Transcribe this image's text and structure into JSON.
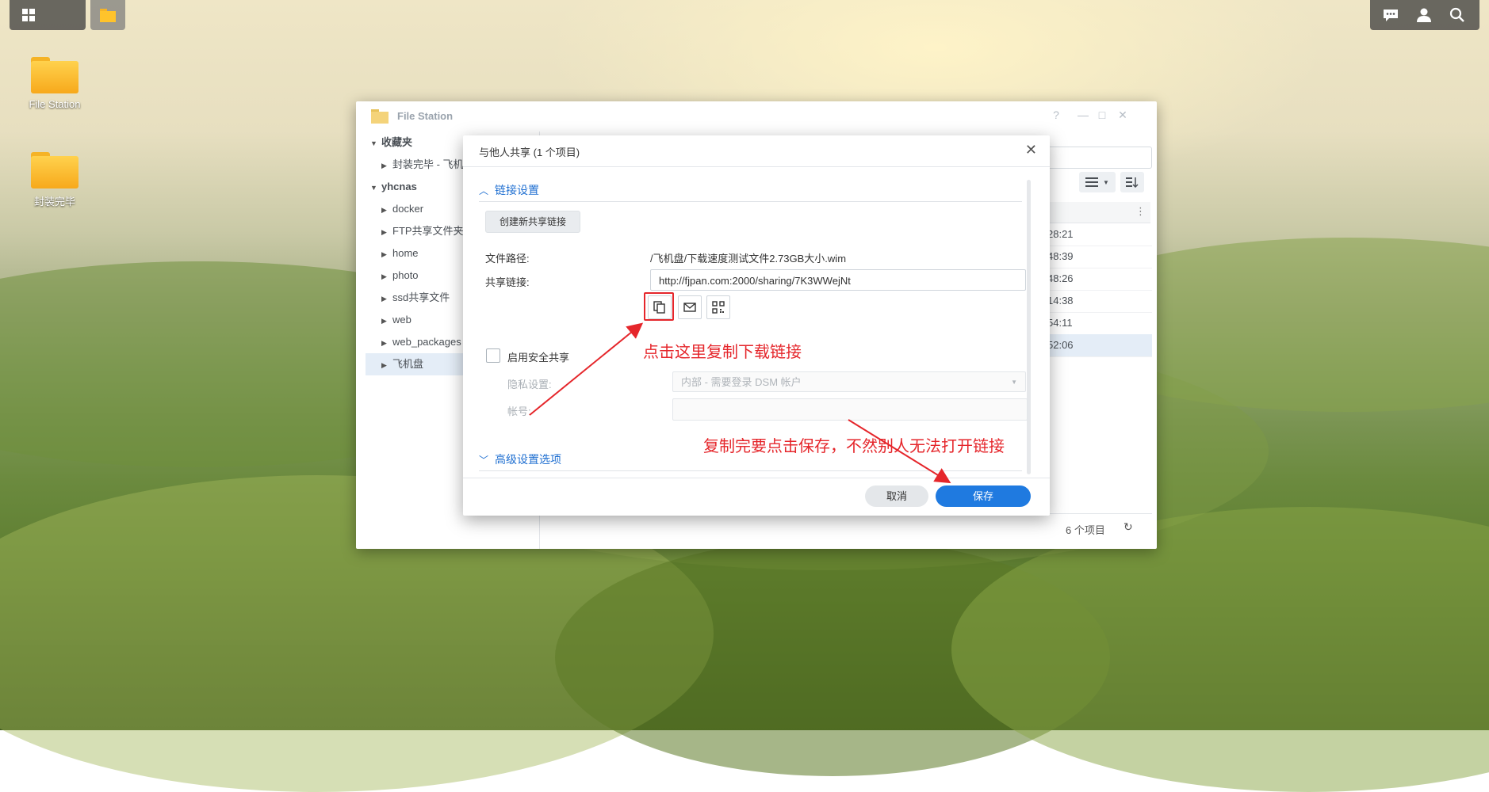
{
  "taskbar": {
    "left_icons": [
      "grid-icon",
      "file-station-icon"
    ],
    "right_icons": [
      "chat-icon",
      "user-icon",
      "search-icon"
    ]
  },
  "desktop": {
    "icons": [
      {
        "label": "File Station"
      },
      {
        "label": "封装完毕"
      }
    ]
  },
  "file_station": {
    "title": "File Station",
    "window_controls": [
      "?",
      "—",
      "□",
      "✕"
    ],
    "tree": [
      {
        "label": "收藏夹",
        "level": 0,
        "expanded": true
      },
      {
        "label": "封装完毕 - 飞机",
        "level": 1,
        "expanded": false
      },
      {
        "label": "yhcnas",
        "level": 0,
        "expanded": true
      },
      {
        "label": "docker",
        "level": 1,
        "expanded": false
      },
      {
        "label": "FTP共享文件夹",
        "level": 1,
        "expanded": false
      },
      {
        "label": "home",
        "level": 1,
        "expanded": false
      },
      {
        "label": "photo",
        "level": 1,
        "expanded": false
      },
      {
        "label": "ssd共享文件",
        "level": 1,
        "expanded": false
      },
      {
        "label": "web",
        "level": 1,
        "expanded": false
      },
      {
        "label": "web_packages",
        "level": 1,
        "expanded": false
      },
      {
        "label": "飞机盘",
        "level": 1,
        "expanded": false,
        "selected": true
      }
    ],
    "times": [
      "28:21",
      "48:39",
      "48:26",
      "14:38",
      "54:11",
      "52:06"
    ],
    "item_count": "6 个项目"
  },
  "dialog": {
    "title": "与他人共享 (1 个项目)",
    "link_section": "链接设置",
    "create_button": "创建新共享链接",
    "path_label": "文件路径:",
    "path_value": "/飞机盘/下载速度测试文件2.73GB大小.wim",
    "link_label": "共享链接:",
    "link_value": "http://fjpan.com:2000/sharing/7K3WWejNt",
    "action_icons": [
      "copy-icon",
      "mail-icon",
      "qr-code-icon"
    ],
    "secure_share_label": "启用安全共享",
    "privacy_label": "隐私设置:",
    "privacy_value": "内部 - 需要登录 DSM 帐户",
    "account_label": "帐号:",
    "advanced_section": "高级设置选项",
    "cancel": "取消",
    "save": "保存"
  },
  "annotations": {
    "copy_hint": "点击这里复制下载链接",
    "save_hint": "复制完要点击保存，不然别人无法打开链接",
    "color": "#e5262b"
  }
}
